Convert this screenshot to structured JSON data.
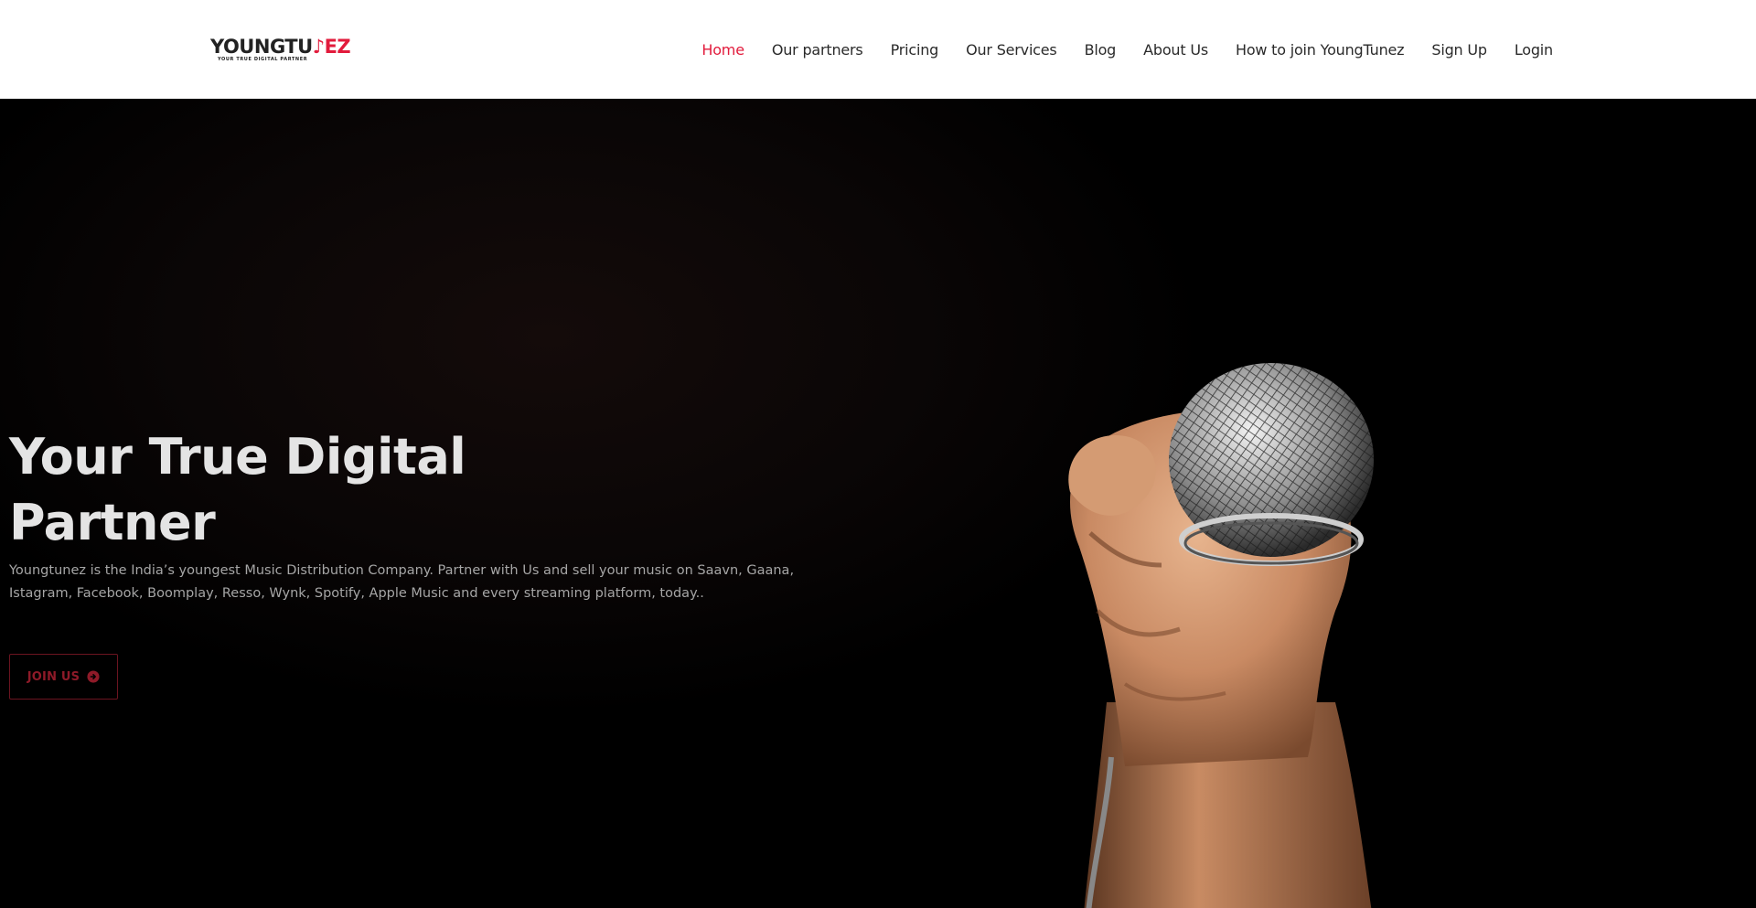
{
  "brand": {
    "logo_main": "YOUNGTU",
    "logo_accent": "♪EZ",
    "tagline": "YOUR TRUE DIGITAL PARTNER",
    "accent_color": "#e21b3c"
  },
  "nav": {
    "items": [
      {
        "label": "Home",
        "active": true
      },
      {
        "label": "Our partners"
      },
      {
        "label": "Pricing"
      },
      {
        "label": "Our Services"
      },
      {
        "label": "Blog"
      },
      {
        "label": "About Us"
      },
      {
        "label": "How to join YoungTunez"
      },
      {
        "label": "Sign Up"
      },
      {
        "label": "Login"
      }
    ]
  },
  "hero": {
    "title": "Your True Digital Partner",
    "description": "Youngtunez is the India’s youngest Music Distribution Company. Partner with Us and sell your music on Saavn, Gaana, Istagram, Facebook, Boomplay, Resso, Wynk, Spotify, Apple Music and every streaming platform, today..",
    "cta_label": "JOIN US",
    "cta_icon": "arrow-circle-right-icon",
    "image": "hand-holding-microphone"
  }
}
